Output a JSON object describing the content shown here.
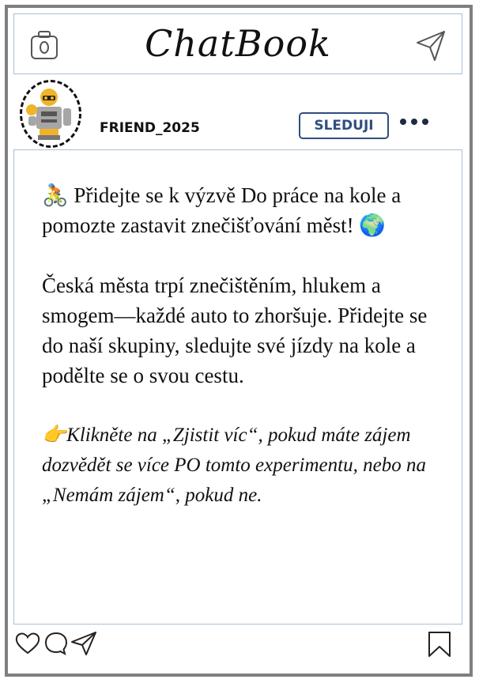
{
  "app": {
    "title": "ChatBook"
  },
  "header_icons": {
    "camera": "camera-icon",
    "send": "send-icon"
  },
  "post": {
    "author": "FRIEND_2025",
    "follow_label": "SLEDUJI",
    "paragraph1_emoji": "🚴",
    "paragraph1_text": " Přidejte se k výzvě Do práce na kole a pomozte zastavit znečišťování měst! ",
    "paragraph1_emoji_end": "🌍",
    "paragraph2": "Česká města trpí znečištěním, hlukem a smogem—každé auto to zhoršuje. Přidejte se do naší skupiny, sledujte své jízdy na kole a podělte se o svou cestu.",
    "cta_emoji": "👉",
    "cta_text": "Klikněte na „Zjistit víc“, pokud máte zájem dozvědět se více PO tomto experimentu, nebo na „Nemám zájem“, pokud ne."
  },
  "footer_icons": [
    "heart-icon",
    "comment-icon",
    "share-icon",
    "bookmark-icon"
  ]
}
